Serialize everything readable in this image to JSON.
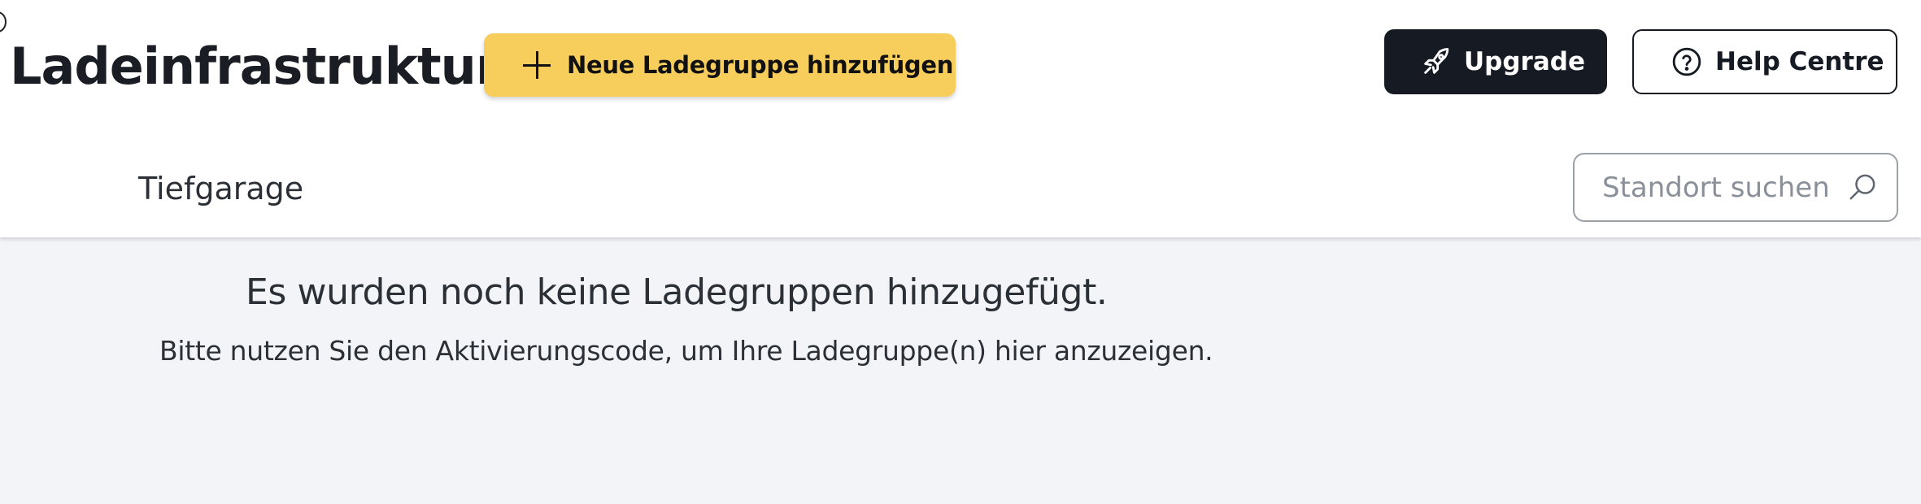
{
  "header": {
    "title": "Ladeinfrastruktur",
    "add_group_label": "Neue Ladegruppe hinzufügen",
    "upgrade_label": "Upgrade",
    "help_label": "Help Centre"
  },
  "subnav": {
    "location_tab": "Tiefgarage"
  },
  "search": {
    "placeholder": "Standort suchen",
    "value": ""
  },
  "empty_state": {
    "title": "Es wurden noch keine Ladegruppen hinzugefügt.",
    "subtitle": "Bitte nutzen Sie den Aktivierungscode, um Ihre Ladegruppe(n) hier anzuzeigen."
  },
  "icons": {
    "add": "plus-icon",
    "upgrade": "rocket-icon",
    "help": "help-circle-icon",
    "search": "search-icon"
  },
  "colors": {
    "accent_yellow": "#f7cd5c",
    "dark": "#161a22",
    "content_background": "#f3f4f8"
  }
}
